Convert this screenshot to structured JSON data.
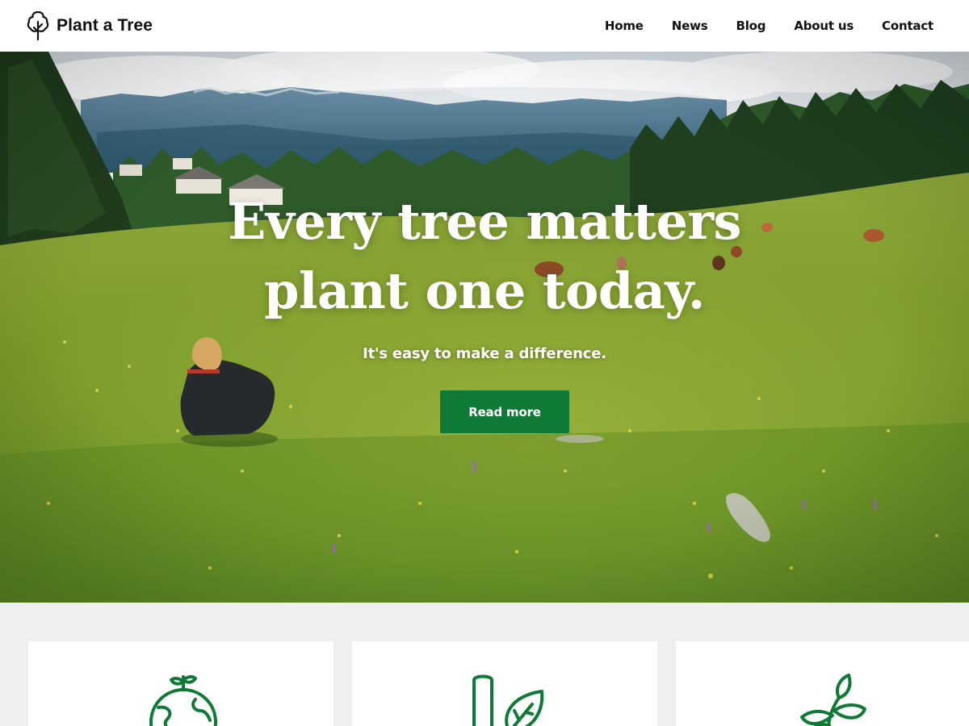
{
  "header": {
    "brand_name": "Plant a Tree",
    "nav": [
      {
        "label": "Home"
      },
      {
        "label": "News"
      },
      {
        "label": "Blog"
      },
      {
        "label": "About us"
      },
      {
        "label": "Contact"
      }
    ]
  },
  "hero": {
    "title_line1": "Every tree matters",
    "title_line2": "plant one today.",
    "subtitle": "It's easy to make a difference.",
    "button_label": "Read more"
  },
  "features": [
    {
      "icon": "globe-sprout-icon"
    },
    {
      "icon": "thermometer-leaf-icon"
    },
    {
      "icon": "leafy-plant-icon"
    }
  ],
  "colors": {
    "accent": "#0f7a35",
    "header_bg": "#ffffff",
    "features_bg": "#efefef",
    "card_bg": "#ffffff",
    "text": "#111111"
  }
}
